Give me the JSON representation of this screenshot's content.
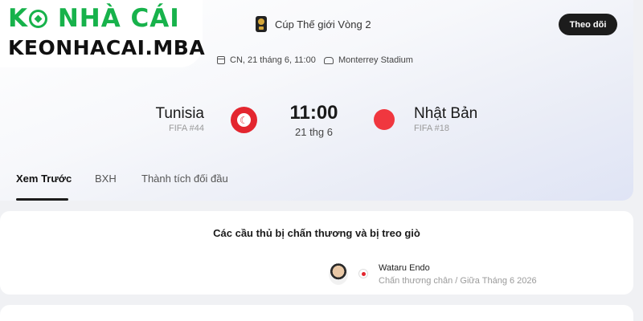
{
  "brand": {
    "line1_before_ball": "K",
    "line1_after_ball": " NHÀ CÁI",
    "line2": "KEONHACAI.MBA"
  },
  "competition": {
    "name": "Cúp Thế giới Vòng 2",
    "follow_label": "Theo dõi"
  },
  "meta": {
    "date": "CN, 21 tháng 6, 11:00",
    "venue": "Monterrey Stadium"
  },
  "match": {
    "home": {
      "name": "Tunisia",
      "rank": "FIFA #44",
      "flag_color": "#e3262f"
    },
    "away": {
      "name": "Nhật Bản",
      "rank": "FIFA #18",
      "flag_color": "#f0373f"
    },
    "time": "11:00",
    "date": "21 thg 6"
  },
  "tabs": [
    {
      "label": "Xem Trước",
      "active": true
    },
    {
      "label": "BXH",
      "active": false
    },
    {
      "label": "Thành tích đối đầu",
      "active": false
    }
  ],
  "injuries": {
    "title": "Các cầu thủ bị chấn thương và bị treo giò",
    "players": [
      {
        "name": "Wataru Endo",
        "status": "Chấn thương chân / Giữa Tháng 6 2026"
      }
    ]
  },
  "colors": {
    "brand_green": "#17b24b",
    "button_dark": "#1c1c1c"
  }
}
